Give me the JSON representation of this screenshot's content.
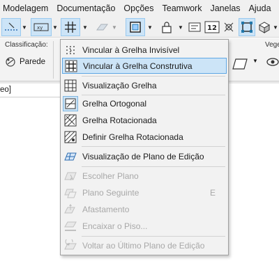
{
  "menubar": {
    "items": [
      "Modelagem",
      "Documentação",
      "Opções",
      "Teamwork",
      "Janelas",
      "Ajuda"
    ]
  },
  "infobox": {
    "classification_label": "Classificação:",
    "wall_button_label": "Parede",
    "right_label": "Vege"
  },
  "canvas": {
    "view_label_fragment": "eo]"
  },
  "menu": {
    "items": [
      {
        "label": "Vincular à Grelha Invisível",
        "icon": "invisible-grid-snap-icon",
        "enabled": true
      },
      {
        "label": "Vincular à Grelha Construtiva",
        "icon": "construction-grid-snap-icon",
        "enabled": true,
        "highlighted": true
      },
      {
        "label": "Visualização Grelha",
        "icon": "grid-display-icon",
        "enabled": true
      },
      {
        "label": "Grelha Ortogonal",
        "icon": "orthogonal-grid-icon",
        "enabled": true
      },
      {
        "label": "Grelha Rotacionada",
        "icon": "rotated-grid-icon",
        "enabled": true
      },
      {
        "label": "Definir Grelha Rotacionada",
        "icon": "define-rotated-grid-icon",
        "enabled": true
      },
      {
        "label": "Visualização de Plano de Edição",
        "icon": "editing-plane-display-icon",
        "enabled": true
      },
      {
        "label": "Escolher Plano",
        "icon": "choose-plane-icon",
        "enabled": false
      },
      {
        "label": "Plano Seguinte",
        "icon": "next-plane-icon",
        "enabled": false,
        "shortcut": "E"
      },
      {
        "label": "Afastamento",
        "icon": "offset-icon",
        "enabled": false
      },
      {
        "label": "Encaixar o Piso...",
        "icon": "fit-to-story-icon",
        "enabled": false
      },
      {
        "label": "Voltar ao Último Plano de Edição",
        "icon": "back-to-last-plane-icon",
        "enabled": false
      }
    ]
  },
  "colors": {
    "highlight_bg": "#cce4f7",
    "highlight_border": "#5ea7e4",
    "disabled_text": "#a8a8a8",
    "menu_bg": "#f2f2f2"
  }
}
